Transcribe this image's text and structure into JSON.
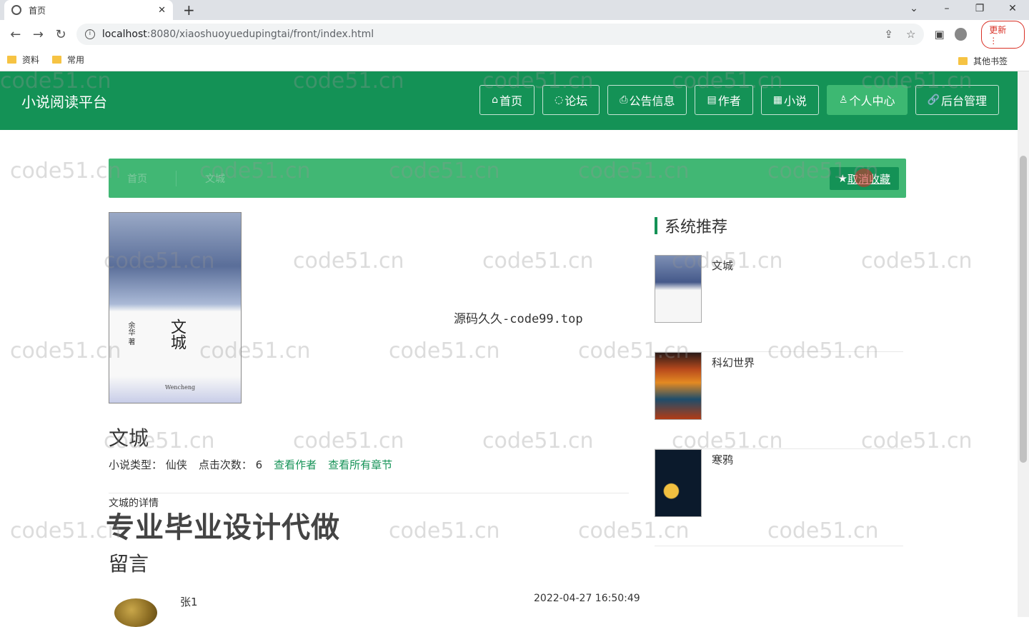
{
  "browser": {
    "tab_title": "首页",
    "url_host": "localhost",
    "url_path": ":8080/xiaoshuoyuedupingtai/front/index.html",
    "update_label": "更新",
    "bookmarks": [
      "资料",
      "常用"
    ],
    "other_bookmarks": "其他书签"
  },
  "site": {
    "logo": "小说阅读平台",
    "nav": [
      {
        "icon": "home-icon",
        "label": "首页"
      },
      {
        "icon": "forum-icon",
        "label": "论坛"
      },
      {
        "icon": "notice-icon",
        "label": "公告信息"
      },
      {
        "icon": "author-icon",
        "label": "作者"
      },
      {
        "icon": "book-icon",
        "label": "小说"
      },
      {
        "icon": "user-icon",
        "label": "个人中心"
      },
      {
        "icon": "link-icon",
        "label": "后台管理"
      }
    ]
  },
  "breadcrumb": {
    "items": [
      "首页",
      "文城"
    ],
    "fav_label": "取消收藏"
  },
  "book": {
    "cover_title": "文城",
    "cover_author": "余华 著",
    "cover_en": "Wencheng",
    "title": "文城",
    "type_label": "小说类型：",
    "type_value": "仙侠",
    "clicks_label": "点击次数：",
    "clicks_value": "6",
    "link_author": "查看作者",
    "link_chapters": "查看所有章节",
    "detail_label": "文城的详情"
  },
  "overlay": {
    "source_text": "源码久久-code99.top",
    "promo_text": "专业毕业设计代做",
    "watermark": "code51.cn"
  },
  "messages": {
    "title": "留言",
    "items": [
      {
        "user": "张1",
        "time": "2022-04-27 16:50:49"
      }
    ]
  },
  "recommend": {
    "title": "系统推荐",
    "items": [
      {
        "name": "文城"
      },
      {
        "name": "科幻世界"
      },
      {
        "name": "寒鸦"
      }
    ]
  }
}
